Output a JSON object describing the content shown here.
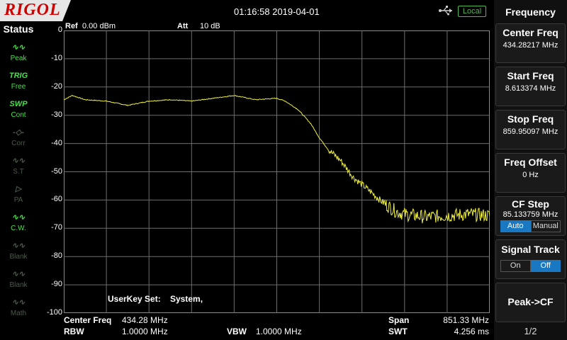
{
  "header": {
    "brand": "RIGOL",
    "datetime": "01:16:58 2019-04-01",
    "local_label": "Local"
  },
  "status": {
    "title": "Status",
    "items": [
      {
        "icon": "peak-icon",
        "glyph": "∿∿",
        "label": "Peak",
        "active": true
      },
      {
        "icon": "trig-icon",
        "glyph": "TRIG",
        "label": "Free",
        "active": true
      },
      {
        "icon": "swp-icon",
        "glyph": "SWP",
        "label": "Cont",
        "active": true
      },
      {
        "icon": "corr-icon",
        "glyph": "-◇-",
        "label": "Corr",
        "active": false
      },
      {
        "icon": "st-icon",
        "glyph": "∿∿",
        "label": "S.T",
        "active": false
      },
      {
        "icon": "pa-icon",
        "glyph": "▷",
        "label": "PA",
        "active": false
      },
      {
        "icon": "cw-icon",
        "glyph": "∿∿",
        "label": "C.W.",
        "active": true
      },
      {
        "icon": "blank1-icon",
        "glyph": "∿∿",
        "label": "Blank",
        "active": false
      },
      {
        "icon": "blank2-icon",
        "glyph": "∿∿",
        "label": "Blank",
        "active": false
      },
      {
        "icon": "math-icon",
        "glyph": "∿∿",
        "label": "Math",
        "active": false
      }
    ]
  },
  "plot": {
    "ref_label": "Ref",
    "ref_value": "0.00 dBm",
    "att_label": "Att",
    "att_value": "10 dB",
    "userkey_label": "UserKey Set:",
    "userkey_value": "System,",
    "yticks": [
      "0",
      "-10",
      "-20",
      "-30",
      "-40",
      "-50",
      "-60",
      "-70",
      "-80",
      "-90",
      "-100"
    ]
  },
  "chart_data": {
    "type": "line",
    "x_range_mhz": [
      8.613374,
      859.95097
    ],
    "ylim": [
      -100,
      0
    ],
    "grid": true,
    "trace_color": "#f0f040",
    "x_fraction": [
      0,
      0.02,
      0.05,
      0.1,
      0.15,
      0.2,
      0.25,
      0.3,
      0.35,
      0.4,
      0.45,
      0.5,
      0.52,
      0.55,
      0.58,
      0.6,
      0.62,
      0.65,
      0.68,
      0.72,
      0.75,
      0.78,
      0.8,
      0.85,
      0.9,
      0.95,
      1.0
    ],
    "y_dbm": [
      -24.5,
      -23,
      -24.5,
      -25,
      -26.5,
      -25,
      -24.5,
      -25,
      -24,
      -23,
      -24.5,
      -24,
      -25,
      -28,
      -33,
      -38,
      -42,
      -46,
      -52,
      -57,
      -61,
      -64,
      -65,
      -66,
      -65.5,
      -65,
      -65.5
    ]
  },
  "bottom": {
    "center_label": "Center Freq",
    "center_value": "434.28 MHz",
    "span_label": "Span",
    "span_value": "851.33 MHz",
    "rbw_label": "RBW",
    "rbw_value": "1.0000 MHz",
    "vbw_label": "VBW",
    "vbw_value": "1.0000 MHz",
    "swt_label": "SWT",
    "swt_value": "4.256 ms"
  },
  "menu": {
    "title": "Frequency",
    "center_freq": {
      "label": "Center Freq",
      "value": "434.28217 MHz"
    },
    "start_freq": {
      "label": "Start Freq",
      "value": "8.613374 MHz"
    },
    "stop_freq": {
      "label": "Stop Freq",
      "value": "859.95097 MHz"
    },
    "freq_offset": {
      "label": "Freq Offset",
      "value": "0 Hz"
    },
    "cf_step": {
      "label": "CF Step",
      "value": "85.133759 MHz",
      "auto": "Auto",
      "manual": "Manual"
    },
    "signal_track": {
      "label": "Signal Track",
      "on": "On",
      "off": "Off"
    },
    "peak_cf": {
      "label": "Peak->CF"
    },
    "page": "1/2"
  },
  "colors": {
    "trace": "#f0f040",
    "active_green": "#4ae04a",
    "selected_blue": "#1a78c2",
    "brand_red": "#d00000"
  }
}
